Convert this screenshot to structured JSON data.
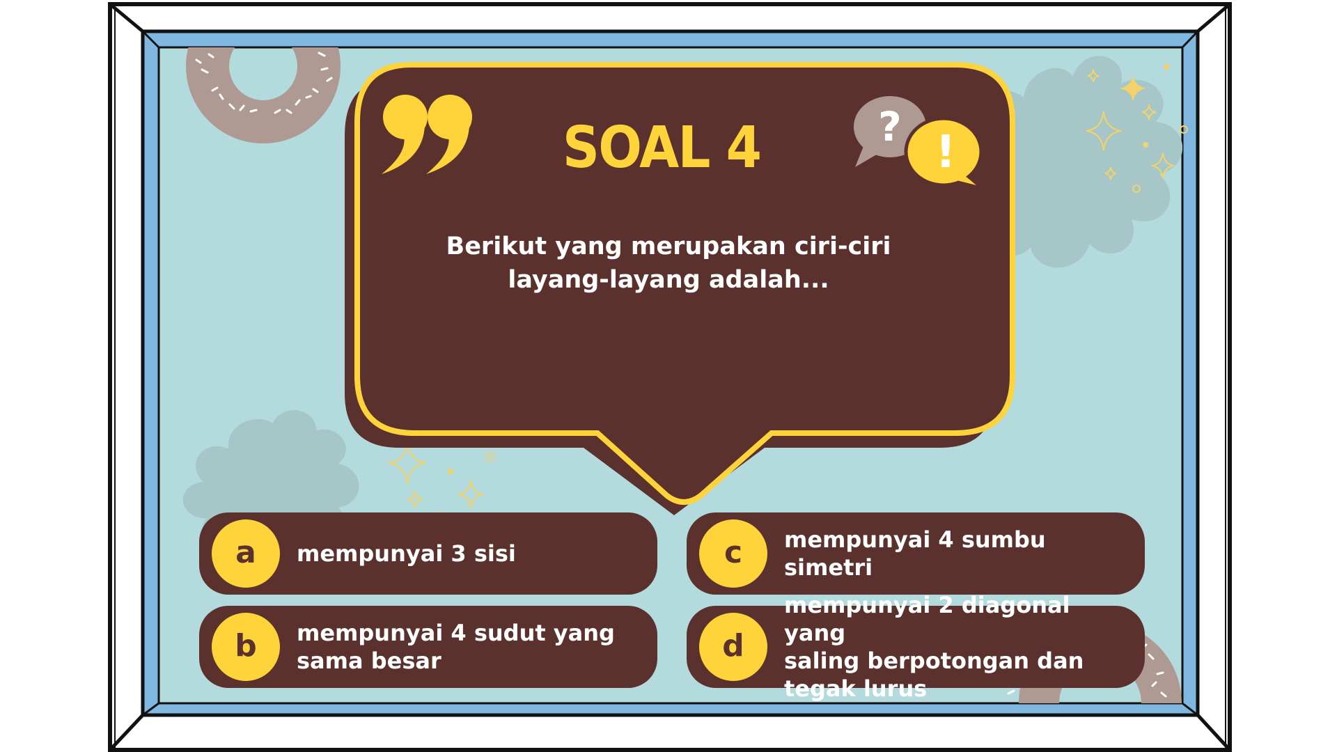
{
  "slide": {
    "title": "SOAL 4",
    "question": "Berikut yang merupakan ciri-ciri\nlayang-layang adalah...",
    "options": [
      {
        "letter": "a",
        "text": "mempunyai 3 sisi"
      },
      {
        "letter": "b",
        "text": "mempunyai 4 sudut yang\nsama besar"
      },
      {
        "letter": "c",
        "text": "mempunyai 4 sumbu simetri"
      },
      {
        "letter": "d",
        "text": "mempunyai 2 diagonal yang\nsaling berpotongan dan\ntegak lurus"
      }
    ]
  },
  "decor": {
    "quote_mark_glyph": "”",
    "question_mark_glyph": "?",
    "exclamation_glyph": "!",
    "icons": [
      "quote-icon",
      "speech-bubble-question-icon",
      "speech-bubble-exclamation-icon",
      "sparkle-icon",
      "flower-shape",
      "donut-shape"
    ]
  },
  "colors": {
    "frame_blue": "#7FB7E0",
    "background_teal": "#B3DADC",
    "flower_gray": "#A6C6C7",
    "card_brown": "#5a312d",
    "accent_yellow": "#FFD43B",
    "donut_taupe": "#AE9A93",
    "text_white": "#ffffff"
  }
}
